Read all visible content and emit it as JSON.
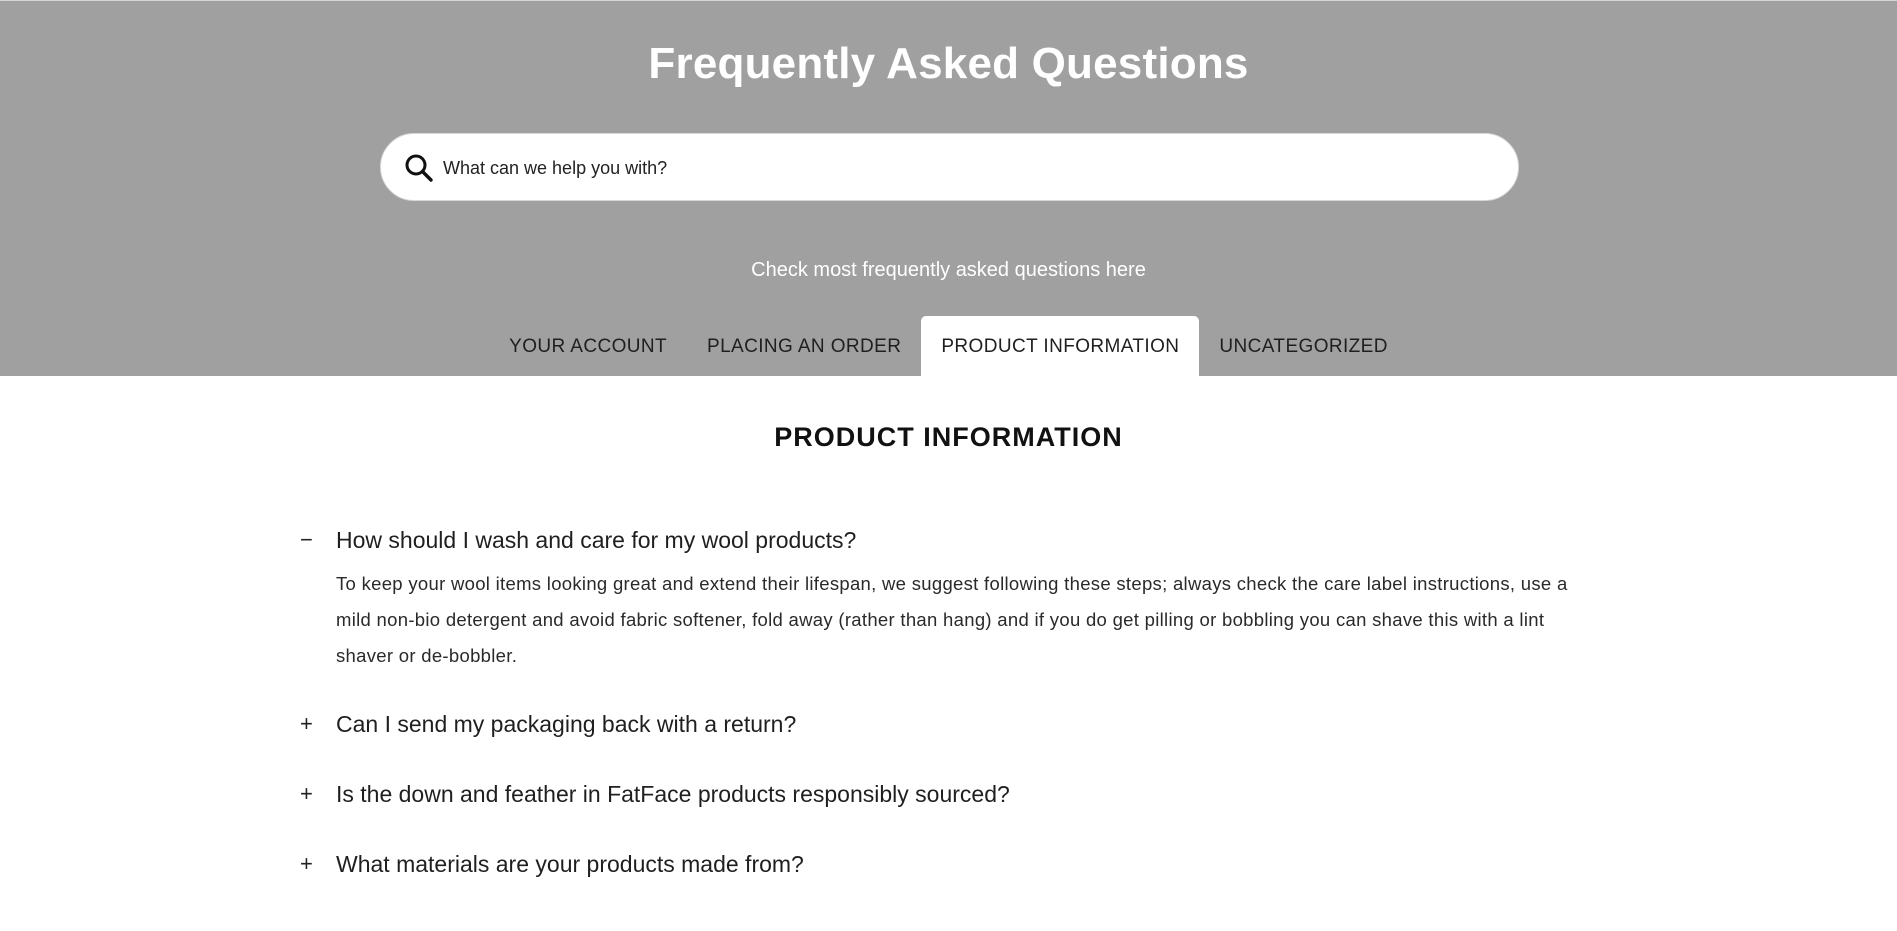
{
  "header": {
    "title": "Frequently Asked Questions",
    "subtitle": "Check most frequently asked questions here"
  },
  "search": {
    "placeholder": "What can we help you with?",
    "value": "",
    "icon": "search-icon"
  },
  "tabs": [
    {
      "label": "YOUR ACCOUNT",
      "active": false
    },
    {
      "label": "PLACING AN ORDER",
      "active": false
    },
    {
      "label": "PRODUCT INFORMATION",
      "active": true
    },
    {
      "label": "UNCATEGORIZED",
      "active": false
    }
  ],
  "section": {
    "title": "PRODUCT INFORMATION"
  },
  "faq": [
    {
      "toggle": "−",
      "question": "How should I wash and care for my wool products?",
      "answer": "To keep your wool items looking great and extend their lifespan, we suggest following these steps; always check the care label instructions, use a mild non-bio detergent and avoid fabric softener, fold away (rather than hang) and if you do get pilling or bobbling you can shave this with a lint shaver or de-bobbler.",
      "expanded": true
    },
    {
      "toggle": "+",
      "question": "Can I send my packaging back with a return?",
      "expanded": false
    },
    {
      "toggle": "+",
      "question": "Is the down and feather in FatFace products responsibly sourced?",
      "expanded": false
    },
    {
      "toggle": "+",
      "question": "What materials are your products made from?",
      "expanded": false
    }
  ],
  "colors": {
    "hero_background": "#a0a0a0",
    "hero_text": "#ffffff",
    "active_tab_background": "#ffffff",
    "body_text": "#1f1f1f"
  }
}
